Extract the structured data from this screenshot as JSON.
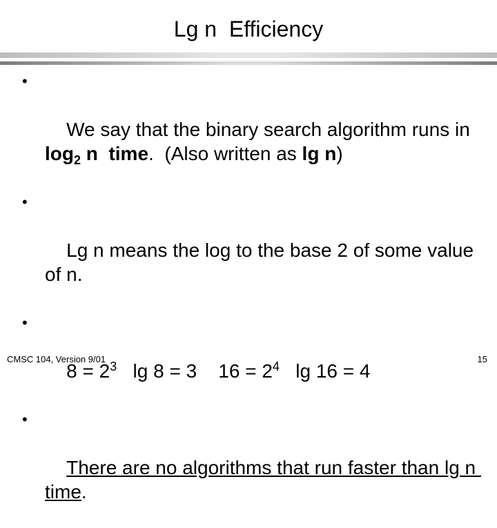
{
  "slide": {
    "title": "Lg n  Efficiency",
    "bullets": [
      {
        "text_a": "We say that the binary search algorithm runs in  ",
        "bold_log": "log",
        "sub_2": "2",
        "bold_n_time": " n  time",
        "text_b": ".  (Also written as ",
        "bold_lgn": "lg n",
        "text_c": ")"
      },
      {
        "text": "Lg n means the log to the base 2 of some value of n."
      },
      {
        "a": "8 = 2",
        "a_sup": "3",
        "b": "   lg 8 = 3    16 = 2",
        "b_sup": "4",
        "c": "   lg 16 = 4"
      },
      {
        "underlined": "There are no algorithms that run faster than lg n time",
        "tail": "."
      }
    ],
    "bullet_glyph": "•"
  },
  "footer": {
    "left": "CMSC 104, Version 9/01",
    "page_number": "15"
  }
}
